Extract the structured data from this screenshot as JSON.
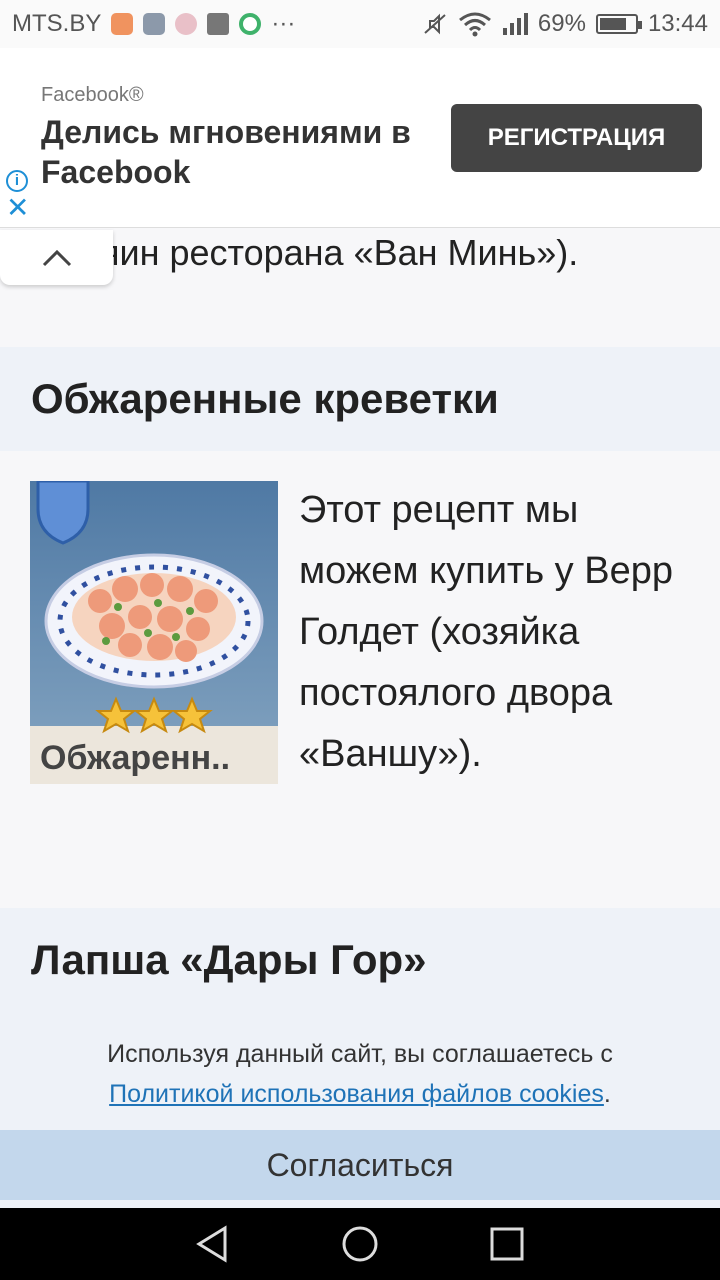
{
  "status_bar": {
    "carrier": "MTS.BY",
    "more": "···",
    "battery_percent": "69%",
    "battery_level": 0.69,
    "time": "13:44"
  },
  "ad": {
    "brand": "Facebook®",
    "title": "Делись мгновениями в Facebook",
    "cta": "РЕГИСТРАЦИЯ"
  },
  "article": {
    "prev_tail": "яин ресторана «Ван Минь»).",
    "section1_title": "Обжаренные креветки",
    "recipe_image_label": "Обжаренн..",
    "recipe_description": "Этот рецепт мы можем купить у Верр Голдет (хозяйка постоялого двора «Ваншу»).",
    "section2_title": "Лапша «Дары Гор»"
  },
  "cookie": {
    "text": "Используя данный сайт, вы соглашаетесь с",
    "link": "Политикой использования файлов cookies",
    "period": ".",
    "button": "Согласиться"
  },
  "colors": {
    "section_bg": "#eef2f8",
    "link": "#1f73b7",
    "cookie_button": "#c3d7ec",
    "ad_button": "#444444"
  }
}
